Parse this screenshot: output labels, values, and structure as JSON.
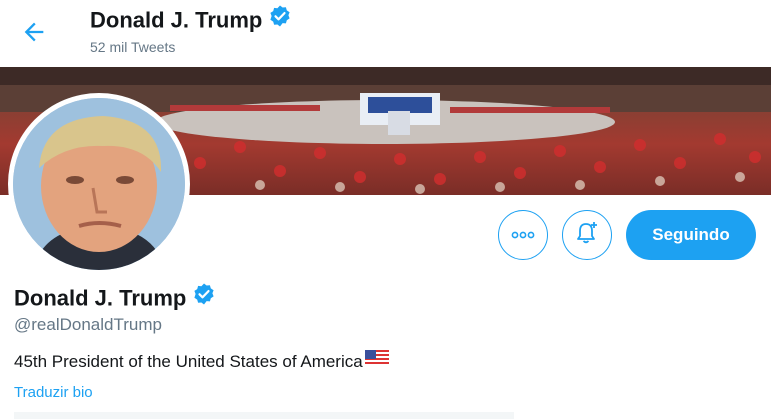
{
  "header": {
    "back_icon": "arrow-left-icon",
    "title": "Donald J. Trump",
    "subtitle": "52 mil Tweets"
  },
  "banner": {
    "description_icon": "rally-crowd-photo"
  },
  "profile": {
    "name": "Donald J. Trump",
    "handle": "@realDonaldTrump",
    "bio": "45th President of the United States of America",
    "translate_link": "Traduzir bio"
  },
  "actions": {
    "more_icon": "more-dots-icon",
    "notify_icon": "bell-plus-icon",
    "follow_label": "Seguindo"
  },
  "colors": {
    "accent": "#1da1f2",
    "text": "#14171a",
    "secondary": "#657786"
  }
}
